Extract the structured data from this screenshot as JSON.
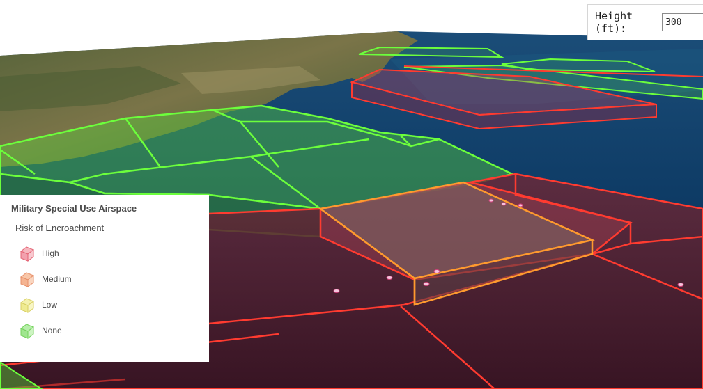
{
  "height_control": {
    "label": "Height (ft):",
    "value": "300"
  },
  "legend": {
    "title": "Military Special Use Airspace",
    "subtitle": "Risk of Encroachment",
    "items": [
      {
        "label": "High",
        "fill": "#f6b7bf",
        "stroke": "#e46475"
      },
      {
        "label": "Medium",
        "fill": "#f8c6a8",
        "stroke": "#e7906a"
      },
      {
        "label": "Low",
        "fill": "#f4f1ad",
        "stroke": "#d8cf63"
      },
      {
        "label": "None",
        "fill": "#b7eeaa",
        "stroke": "#73d25b"
      }
    ]
  },
  "colors": {
    "high": "#ff3b30",
    "medium": "#ff9a2e",
    "none": "#6cff3c",
    "ocean": "#0b3a63",
    "land": "#6b6a3f"
  }
}
